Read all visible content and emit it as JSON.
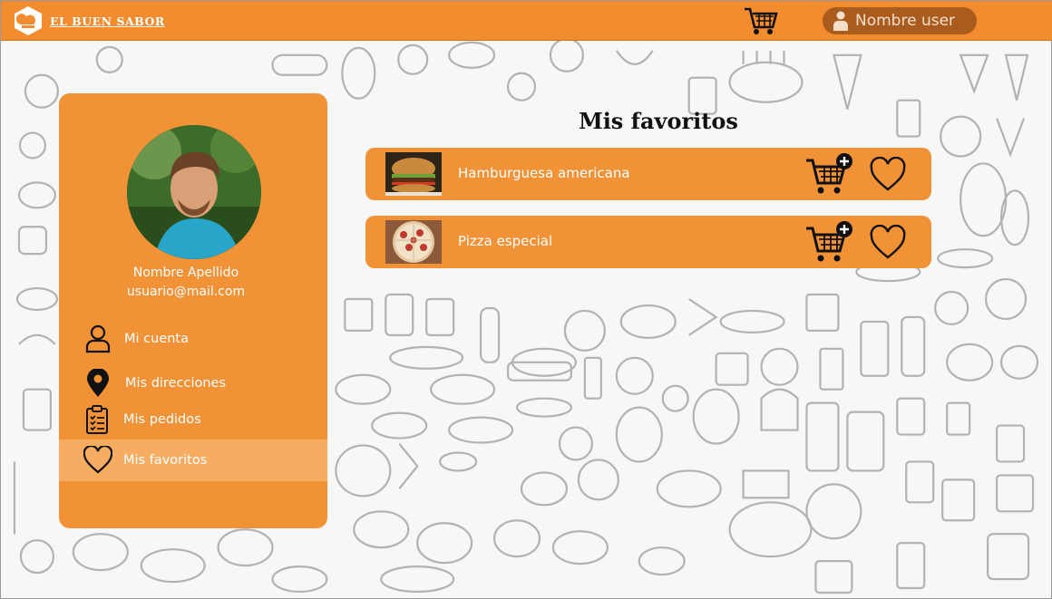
{
  "brand": {
    "name": "EL BUEN SABOR"
  },
  "header": {
    "cart_icon": "shopping-cart-icon",
    "user_name": "Nombre user",
    "user_icon": "user-icon"
  },
  "profile": {
    "name": "Nombre Apellido",
    "email": "usuario@mail.com"
  },
  "menu": {
    "items": [
      {
        "label": "Mi cuenta",
        "icon": "user-outline-icon",
        "active": false
      },
      {
        "label": "Mis direcciones",
        "icon": "location-pin-icon",
        "active": false
      },
      {
        "label": "Mis pedidos",
        "icon": "checklist-icon",
        "active": false
      },
      {
        "label": "Mis favoritos",
        "icon": "heart-icon",
        "active": true
      }
    ]
  },
  "main": {
    "title": "Mis favoritos",
    "favorites": [
      {
        "name": "Hamburguesa americana",
        "thumb": "hamburger-photo"
      },
      {
        "name": "Pizza especial",
        "thumb": "pizza-photo"
      }
    ]
  },
  "colors": {
    "primary": "#f28c2e",
    "card": "#f29237",
    "active_item": "#f6ad62",
    "user_pill": "#a95c1e"
  }
}
